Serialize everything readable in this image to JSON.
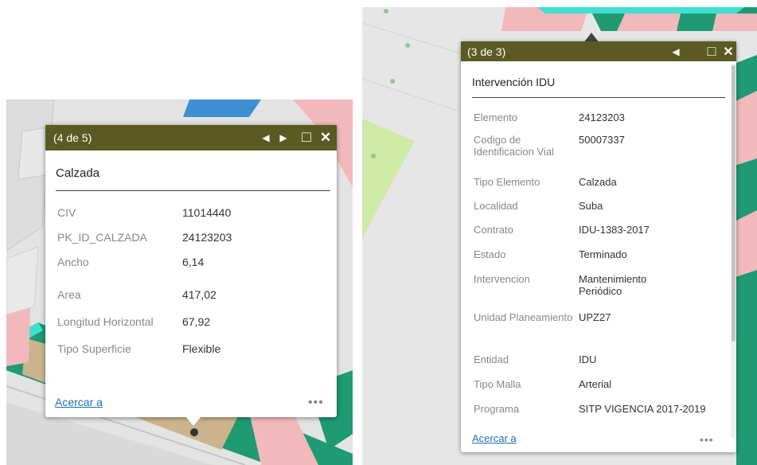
{
  "left_popup": {
    "counter": "(4 de 5)",
    "title": "Calzada",
    "fields": [
      {
        "label": "CIV",
        "value": "11014440"
      },
      {
        "label": "PK_ID_CALZADA",
        "value": "24123203"
      },
      {
        "label": "Ancho",
        "value": "6,14"
      },
      {
        "label": "Area",
        "value": "417,02"
      },
      {
        "label": "Longitud Horizontal",
        "value": "67,92"
      },
      {
        "label": "Tipo Superficie",
        "value": "Flexible"
      }
    ],
    "zoom_link": "Acercar a",
    "more": "•••"
  },
  "right_popup": {
    "counter": "(3 de 3)",
    "title": "Intervención IDU",
    "fields": [
      {
        "label": "Elemento",
        "value": "24123203"
      },
      {
        "label": "Codigo de Identificacion Vial",
        "value": "50007337"
      },
      {
        "label": "Tipo Elemento",
        "value": "Calzada"
      },
      {
        "label": "Localidad",
        "value": "Suba"
      },
      {
        "label": "Contrato",
        "value": "IDU-1383-2017"
      },
      {
        "label": "Estado",
        "value": "Terminado"
      },
      {
        "label": "Intervencion",
        "value": "Mantenimiento Periódico"
      },
      {
        "label": "Unidad Planeamiento",
        "value": "UPZ27"
      },
      {
        "label": "Entidad",
        "value": "IDU"
      },
      {
        "label": "Tipo Malla",
        "value": "Arterial"
      },
      {
        "label": "Programa",
        "value": "SITP VIGENCIA 2017-2019"
      }
    ],
    "zoom_link": "Acercar a",
    "more": "•••"
  },
  "controls": {
    "prev": "◀",
    "next": "▶",
    "maximize": "□",
    "close": "✕"
  },
  "colors": {
    "titlebar": "#5b5a22",
    "link": "#1f6fb2",
    "map_green": "#1f9a73",
    "map_pink": "#f2b9bd",
    "map_blue": "#3e8fd1",
    "map_tan": "#cbb48d",
    "map_cyan": "#3fe0d0",
    "map_lightgreen": "#cfe9a7"
  }
}
